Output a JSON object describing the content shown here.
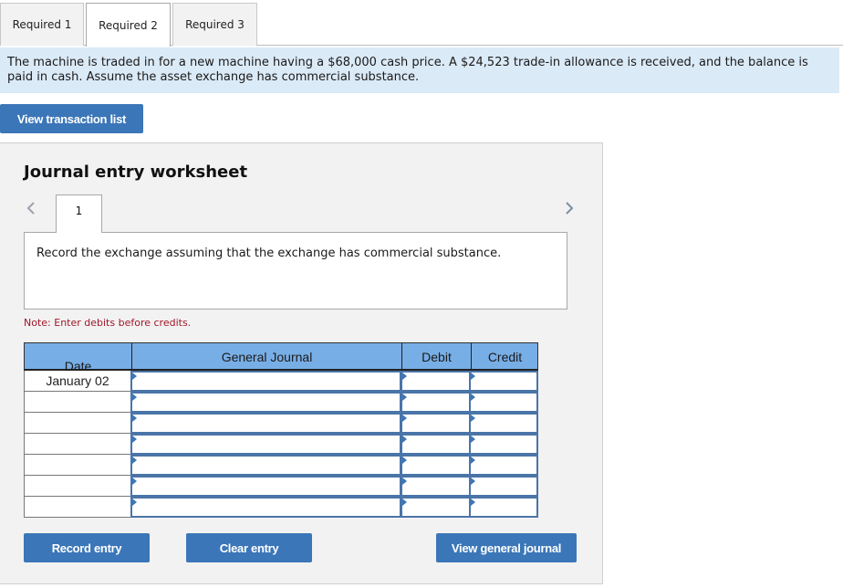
{
  "tabs": [
    {
      "label": "Required 1",
      "active": false
    },
    {
      "label": "Required 2",
      "active": true
    },
    {
      "label": "Required 3",
      "active": false
    }
  ],
  "problem": {
    "text": "The machine is traded in for a new machine having a $68,000 cash price. A $24,523 trade-in allowance is received, and the balance is paid in cash. Assume the asset exchange has commercial substance."
  },
  "buttons": {
    "view_transaction_list": "View transaction list",
    "record_entry": "Record entry",
    "clear_entry": "Clear entry",
    "view_general_journal": "View general journal"
  },
  "worksheet": {
    "title": "Journal entry worksheet",
    "entry_tabs": [
      "1"
    ],
    "instruction": "Record the exchange assuming that the exchange has commercial substance.",
    "note": "Note: Enter debits before credits.",
    "columns": {
      "date": "Date",
      "general_journal": "General Journal",
      "debit": "Debit",
      "credit": "Credit"
    },
    "rows": [
      {
        "date": "January 02",
        "account": "",
        "debit": "",
        "credit": ""
      },
      {
        "date": "",
        "account": "",
        "debit": "",
        "credit": ""
      },
      {
        "date": "",
        "account": "",
        "debit": "",
        "credit": ""
      },
      {
        "date": "",
        "account": "",
        "debit": "",
        "credit": ""
      },
      {
        "date": "",
        "account": "",
        "debit": "",
        "credit": ""
      },
      {
        "date": "",
        "account": "",
        "debit": "",
        "credit": ""
      },
      {
        "date": "",
        "account": "",
        "debit": "",
        "credit": ""
      }
    ]
  },
  "colors": {
    "button": "#3b76b8",
    "banner_bg": "#dbeaf7",
    "table_header": "#78aee6",
    "note_text": "#a0182a"
  }
}
